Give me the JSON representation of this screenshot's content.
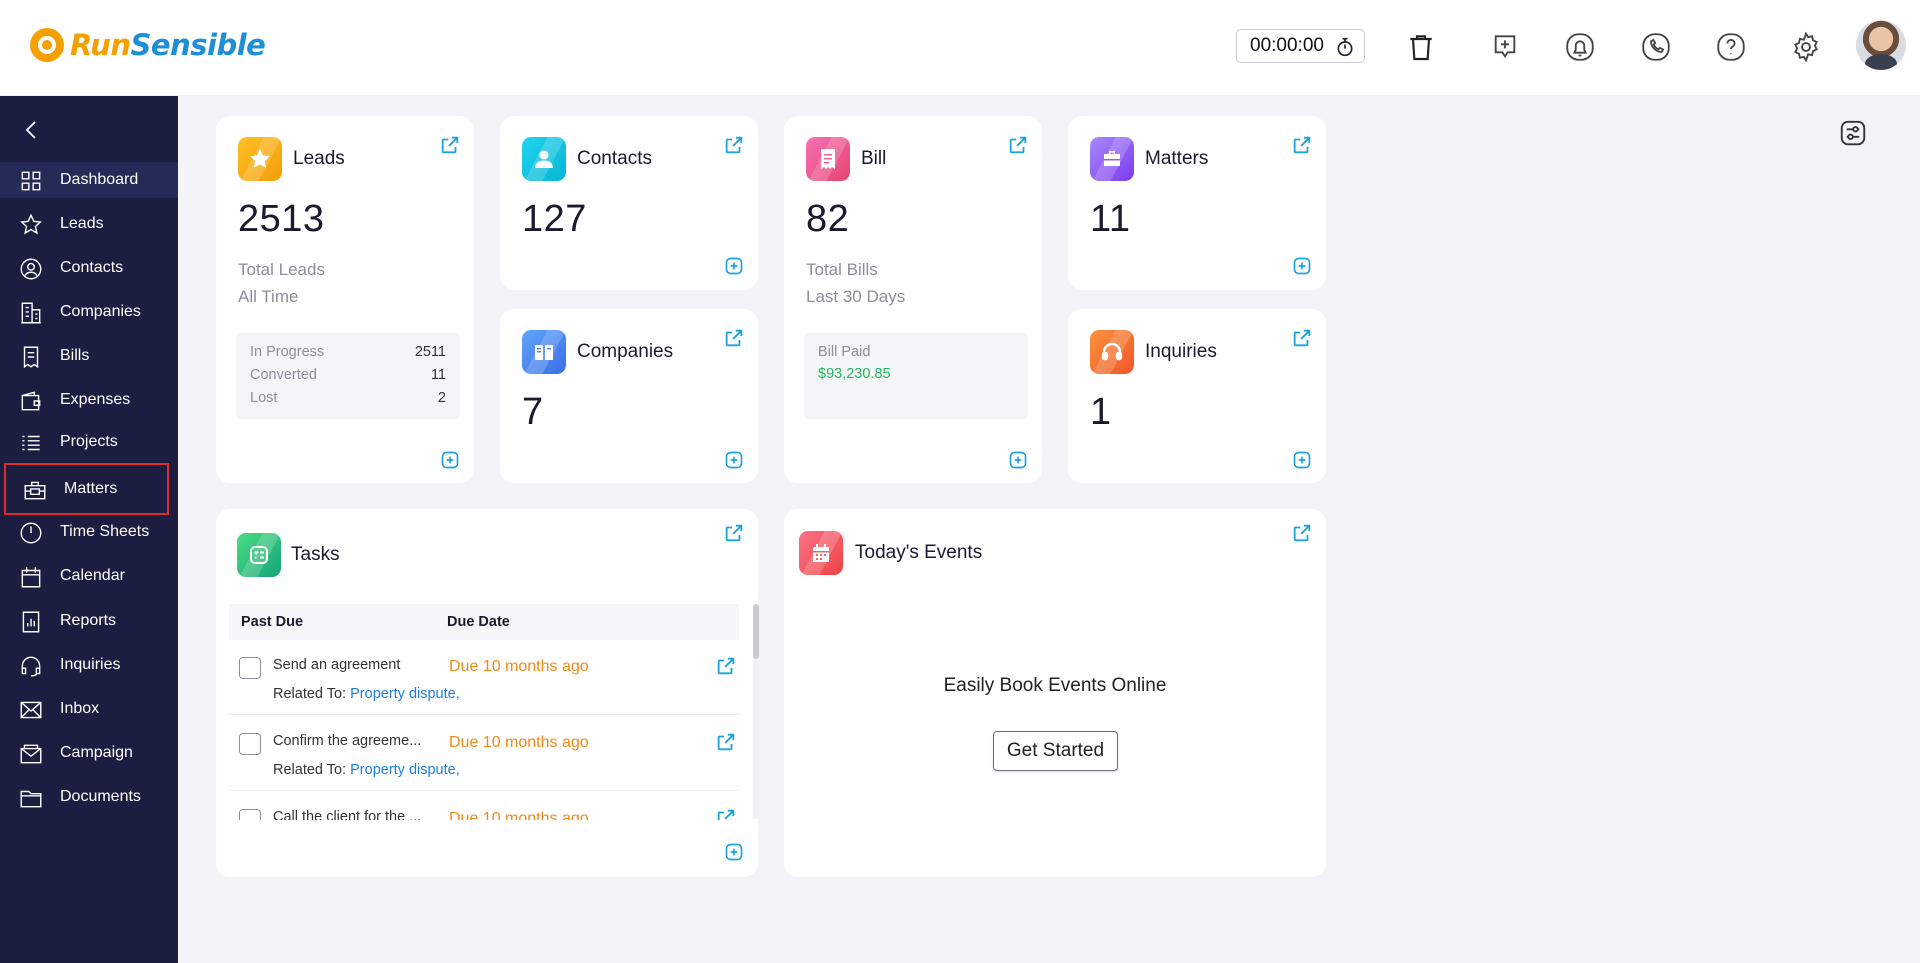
{
  "header": {
    "logo_run": "Run",
    "logo_sensible": "Sensible",
    "timer": "00:00:00",
    "icons": [
      "trash-icon",
      "add-reminder-icon",
      "bell-icon",
      "phone-icon",
      "help-icon",
      "gear-icon"
    ]
  },
  "sidebar": {
    "items": [
      {
        "label": "Dashboard",
        "icon": "dashboard-icon"
      },
      {
        "label": "Leads",
        "icon": "star-icon"
      },
      {
        "label": "Contacts",
        "icon": "user-icon"
      },
      {
        "label": "Companies",
        "icon": "building-icon"
      },
      {
        "label": "Bills",
        "icon": "receipt-icon"
      },
      {
        "label": "Expenses",
        "icon": "wallet-icon"
      },
      {
        "label": "Projects",
        "icon": "list-icon"
      },
      {
        "label": "Matters",
        "icon": "briefcase-icon"
      },
      {
        "label": "Time Sheets",
        "icon": "clock-icon"
      },
      {
        "label": "Calendar",
        "icon": "calendar-icon"
      },
      {
        "label": "Reports",
        "icon": "chart-icon"
      },
      {
        "label": "Inquiries",
        "icon": "headset-icon"
      },
      {
        "label": "Inbox",
        "icon": "mail-icon"
      },
      {
        "label": "Campaign",
        "icon": "envelope-icon"
      },
      {
        "label": "Documents",
        "icon": "folder-icon"
      }
    ]
  },
  "leads": {
    "title": "Leads",
    "count": "2513",
    "sub1": "Total Leads",
    "sub2": "All Time",
    "stats": [
      {
        "label": "In Progress",
        "value": "2511"
      },
      {
        "label": "Converted",
        "value": "11"
      },
      {
        "label": "Lost",
        "value": "2"
      }
    ]
  },
  "contacts": {
    "title": "Contacts",
    "count": "127"
  },
  "companies": {
    "title": "Companies",
    "count": "7"
  },
  "bill": {
    "title": "Bill",
    "count": "82",
    "sub1": "Total Bills",
    "sub2": "Last 30 Days",
    "paid_label": "Bill Paid",
    "paid_value": "$93,230.85"
  },
  "matters": {
    "title": "Matters",
    "count": "11"
  },
  "inquiries": {
    "title": "Inquiries",
    "count": "1"
  },
  "tasks": {
    "title": "Tasks",
    "col_past_due": "Past Due",
    "col_due_date": "Due Date",
    "related_label": "Related To:",
    "rows": [
      {
        "name": "Send an agreement",
        "due": "Due 10 months ago",
        "related": "Property dispute,"
      },
      {
        "name": "Confirm the agreeme...",
        "due": "Due 10 months ago",
        "related": "Property dispute,"
      },
      {
        "name": "Call the client for the ...",
        "due": "Due 10 months ago",
        "related": ""
      }
    ]
  },
  "events": {
    "title": "Today's Events",
    "empty_text": "Easily Book Events Online",
    "button": "Get Started"
  },
  "colors": {
    "sidebar": "#1b1d41",
    "accent": "#1aa3dd",
    "orange": "#f08a16",
    "highlight": "#e02b2b"
  }
}
